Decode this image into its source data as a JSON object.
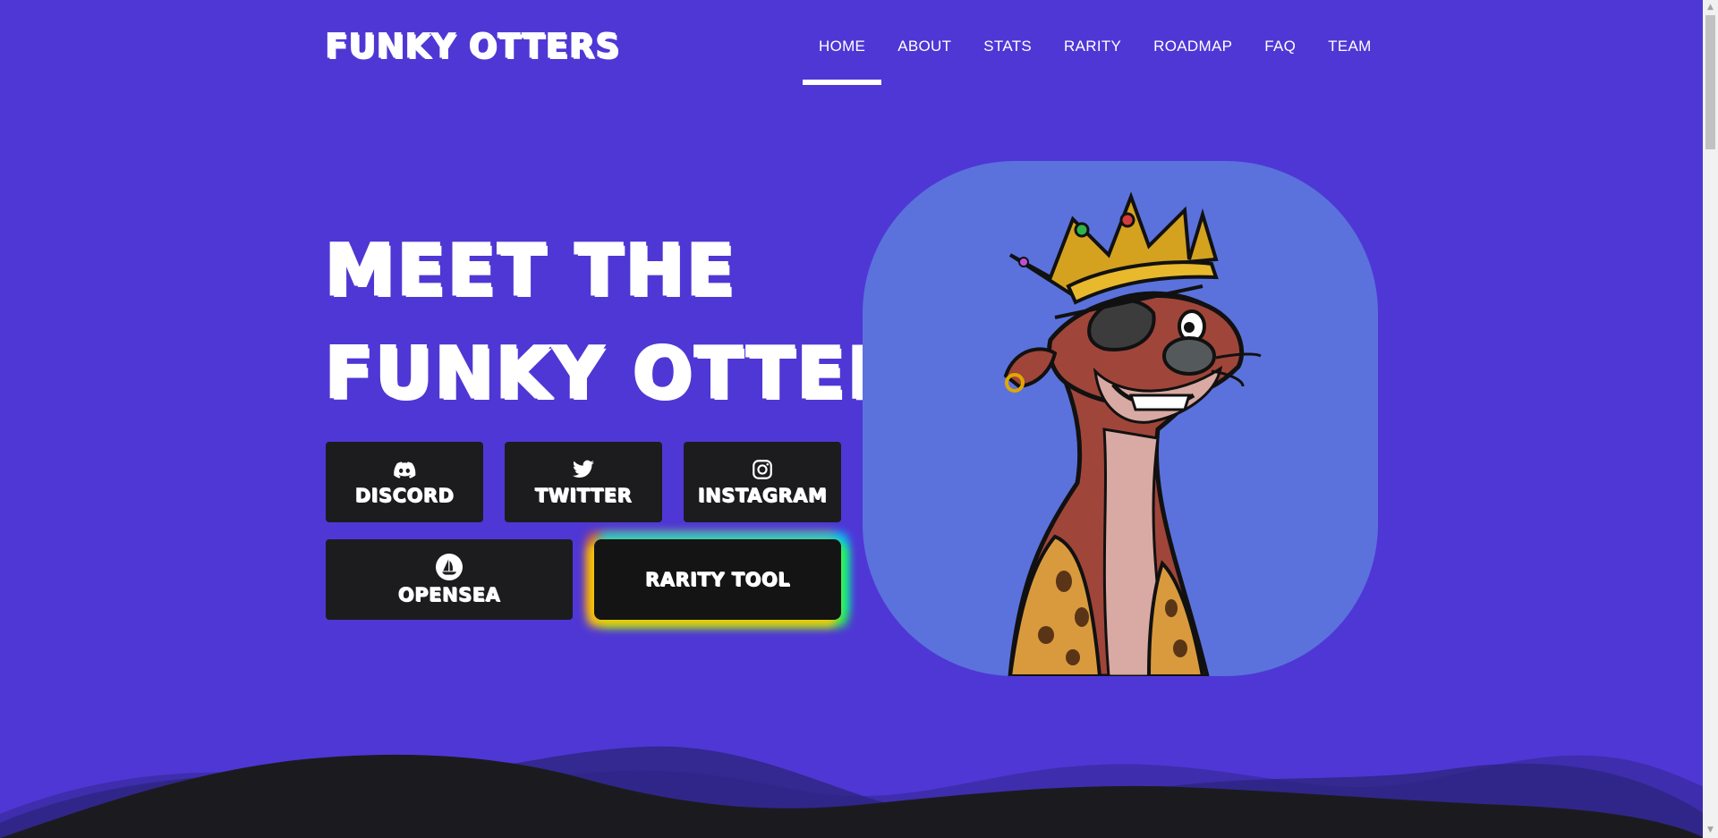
{
  "header": {
    "logo": "FUNKY OTTERS",
    "nav": [
      {
        "label": "HOME",
        "active": true
      },
      {
        "label": "ABOUT",
        "active": false
      },
      {
        "label": "STATS",
        "active": false
      },
      {
        "label": "RARITY",
        "active": false
      },
      {
        "label": "ROADMAP",
        "active": false
      },
      {
        "label": "FAQ",
        "active": false
      },
      {
        "label": "TEAM",
        "active": false
      }
    ]
  },
  "hero": {
    "title_line1": "MEET THE",
    "title_line2": "FUNKY OTTERS",
    "buttons": {
      "discord": {
        "label": "DISCORD",
        "icon": "discord-icon"
      },
      "twitter": {
        "label": "TWITTER",
        "icon": "twitter-icon"
      },
      "instagram": {
        "label": "INSTAGRAM",
        "icon": "instagram-icon"
      },
      "opensea": {
        "label": "OPENSEA",
        "icon": "opensea-icon"
      },
      "rarity": {
        "label": "RARITY TOOL"
      }
    }
  },
  "colors": {
    "background": "#4f37d5",
    "button_bg": "#1c1c1f",
    "otter_frame_bg": "#5b72dd",
    "wave_dark": "#1b1b1f"
  }
}
